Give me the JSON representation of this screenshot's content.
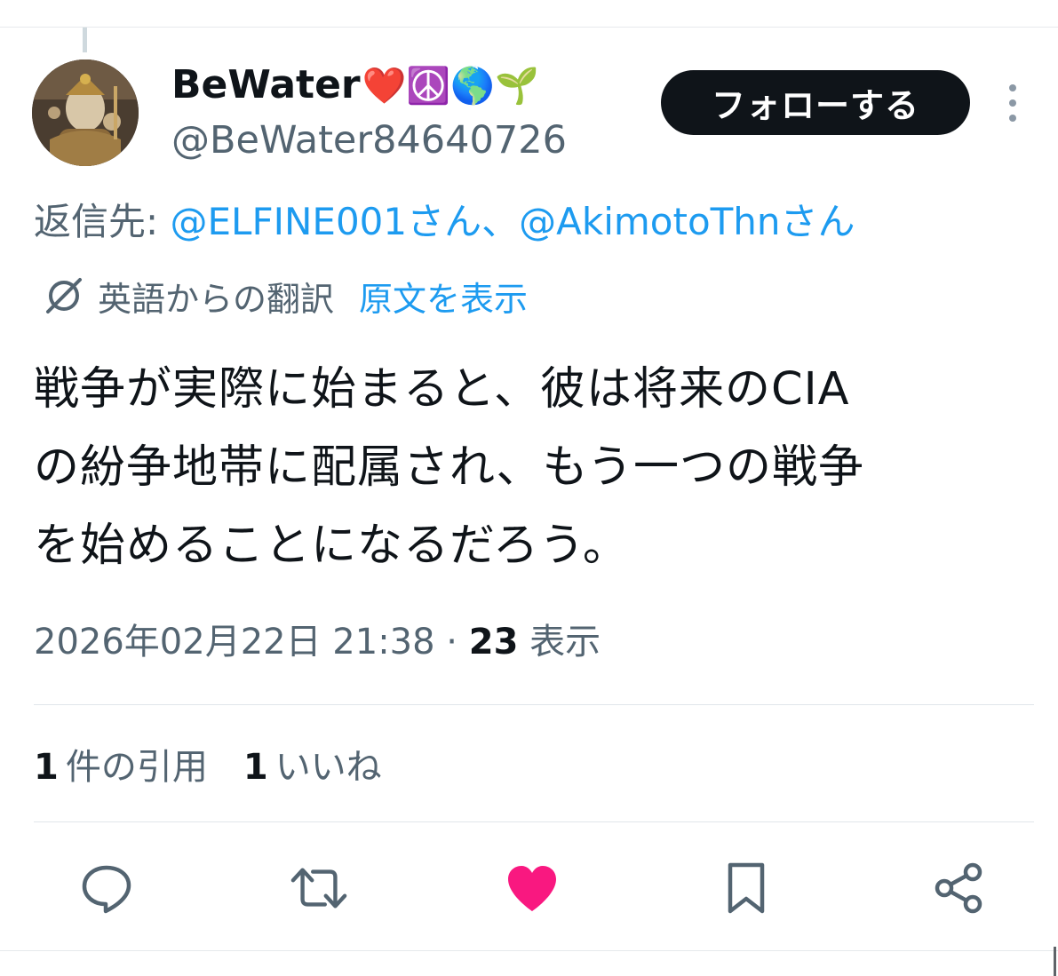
{
  "author": {
    "display_name": "BeWater",
    "name_emojis": "❤️☮️🌎🌱",
    "handle": "@BeWater84640726"
  },
  "follow_label": "フォローする",
  "reply": {
    "prefix": "返信先: ",
    "mention_1": "@ELFINE001",
    "suffix_1": "さん、",
    "mention_2": "@AkimotoThn",
    "suffix_2": "さん"
  },
  "translation": {
    "label": "英語からの翻訳",
    "show_original": "原文を表示"
  },
  "tweet": {
    "lines": [
      "戦争が実際に始まると、彼は将来のCIA",
      "の紛争地帯に配属され、もう一つの戦争",
      "を始めることになるだろう。"
    ]
  },
  "meta": {
    "timestamp": "2026年02月22日 21:38",
    "separator": " · ",
    "views_count": "23",
    "views_label": " 表示"
  },
  "stats": {
    "quotes_count": "1",
    "quotes_label": "件の引用",
    "likes_count": "1",
    "likes_label": "いいね"
  },
  "actions": [
    "reply-icon",
    "retweet-icon",
    "like-icon-filled",
    "bookmark-icon",
    "share-icon"
  ],
  "colors": {
    "accent": "#1d9bf0",
    "muted": "#536471",
    "like": "#f91880",
    "icon": "#536471"
  }
}
